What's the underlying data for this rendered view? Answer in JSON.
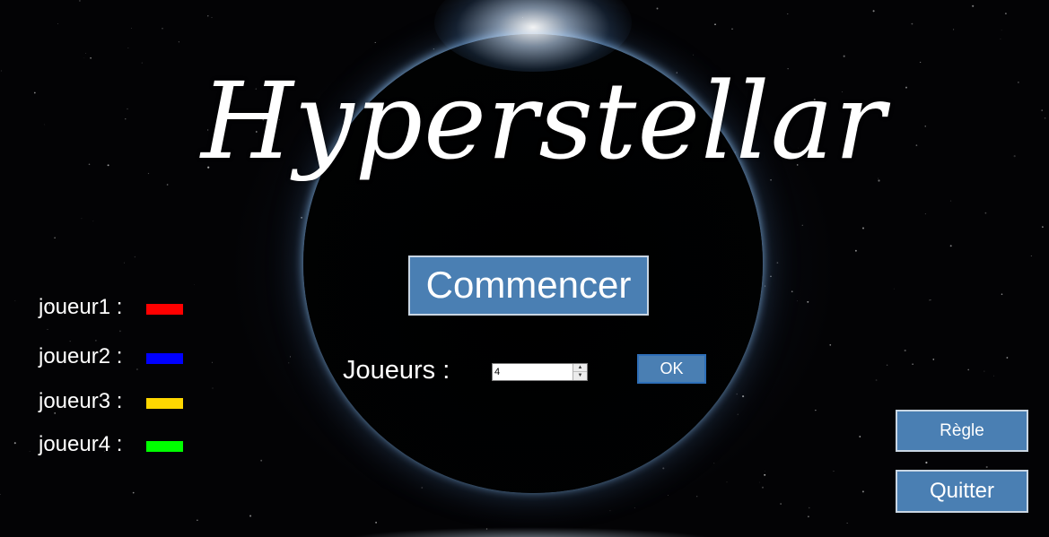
{
  "app": {
    "title": "Hyperstellar"
  },
  "menu": {
    "start_label": "Commencer",
    "players_label": "Joueurs :",
    "players_value": "4",
    "ok_label": "OK",
    "rules_label": "Règle",
    "quit_label": "Quitter"
  },
  "players": [
    {
      "label": "joueur1 :",
      "color": "#ff0000"
    },
    {
      "label": "joueur2 :",
      "color": "#0000ff"
    },
    {
      "label": "joueur3 :",
      "color": "#ffd700"
    },
    {
      "label": "joueur4 :",
      "color": "#00ff00"
    }
  ],
  "colors": {
    "button_bg": "#4a7fb3",
    "button_border": "#c9d6e3",
    "background": "#000000",
    "text": "#ffffff"
  },
  "icons": {
    "spinner_up": "spin-up-arrow-icon",
    "spinner_down": "spin-down-arrow-icon"
  }
}
